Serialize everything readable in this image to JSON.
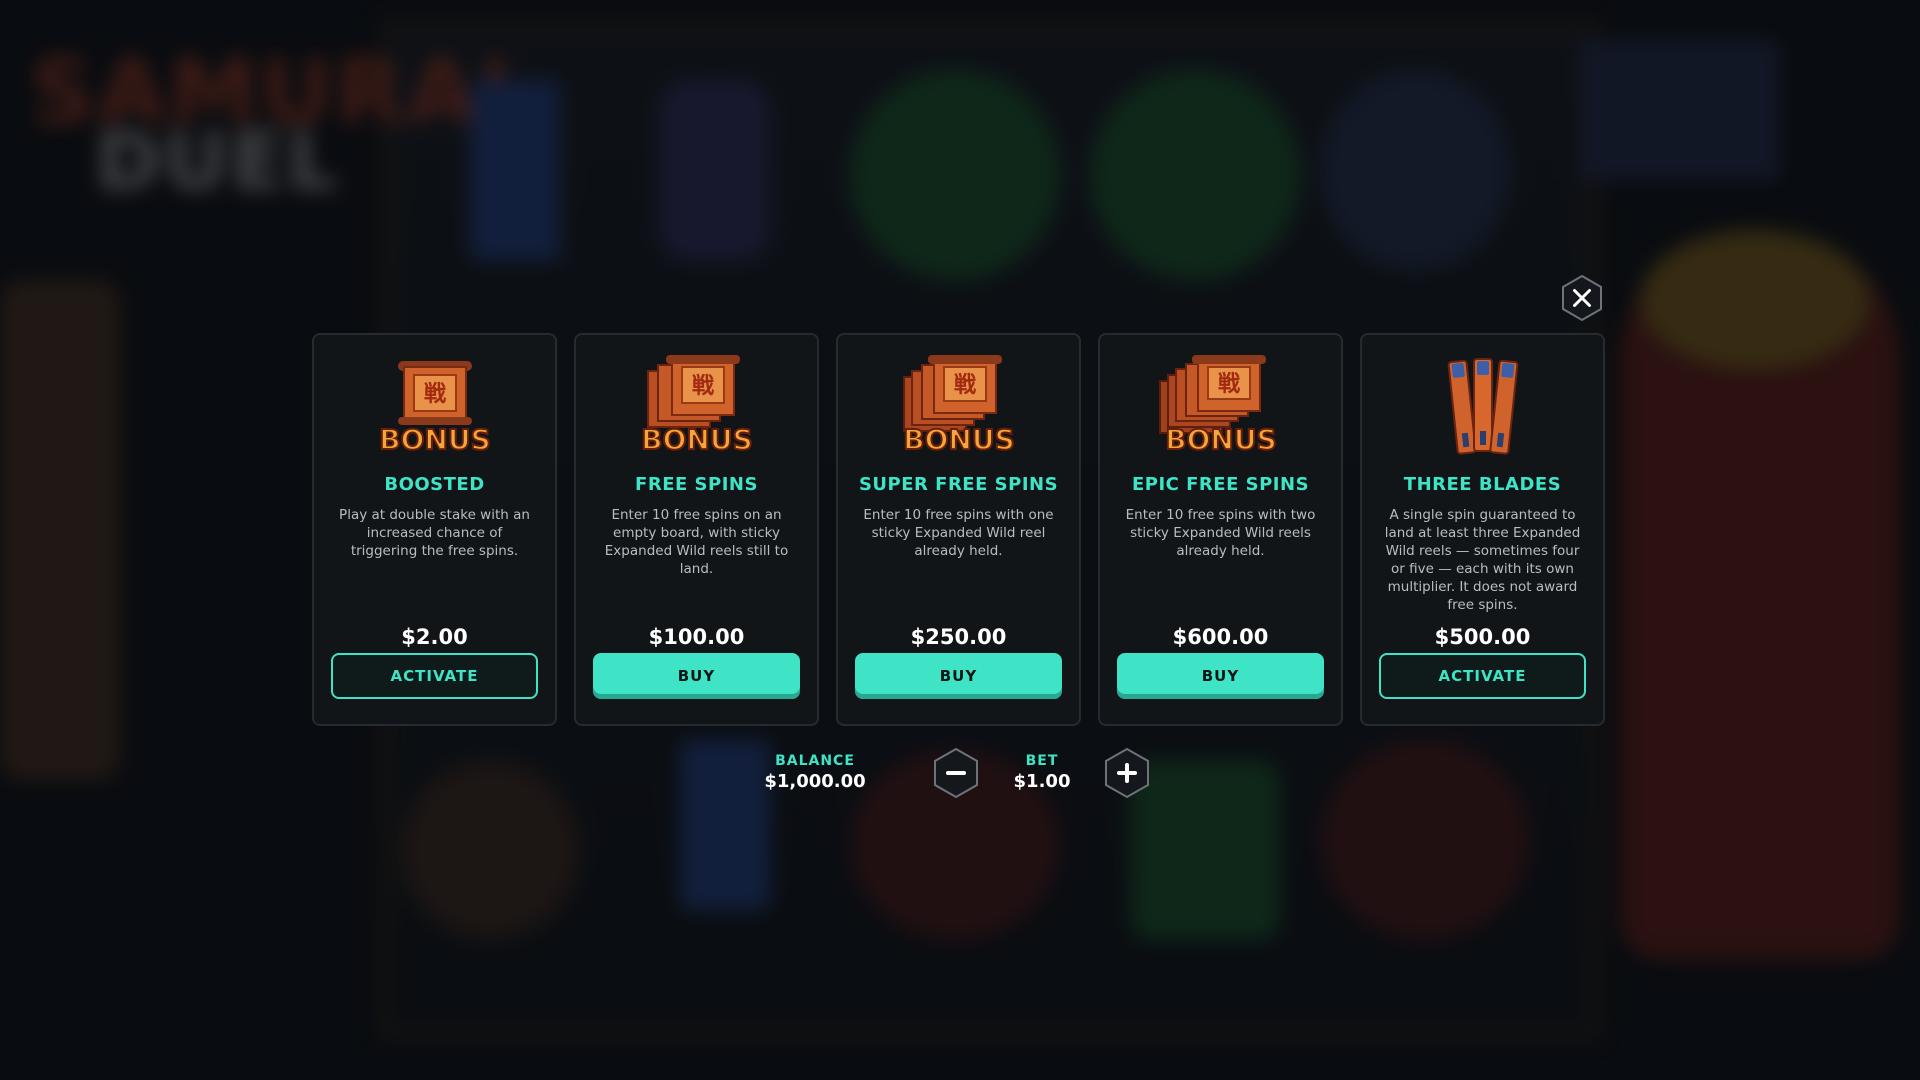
{
  "background": {
    "logo_line1": "SAMURAI",
    "logo_line2": "DUEL"
  },
  "cards": [
    {
      "id": "boosted",
      "title": "BOOSTED",
      "description": "Play at double stake with an increased chance of triggering the free spins.",
      "price": "$2.00",
      "button": "ACTIVATE",
      "button_style": "outline",
      "icon": "bonus-scroll-icon",
      "icon_text": "BONUS"
    },
    {
      "id": "free-spins",
      "title": "FREE SPINS",
      "description": "Enter 10 free spins on an empty board, with sticky Expanded Wild reels still to land.",
      "price": "$100.00",
      "button": "BUY",
      "button_style": "solid",
      "icon": "bonus-scroll-stack-icon",
      "icon_text": "BONUS"
    },
    {
      "id": "super-free-spins",
      "title": "SUPER FREE SPINS",
      "description": "Enter 10 free spins with one sticky Expanded Wild reel already held.",
      "price": "$250.00",
      "button": "BUY",
      "button_style": "solid",
      "icon": "bonus-scroll-stack-icon",
      "icon_text": "BONUS"
    },
    {
      "id": "epic-free-spins",
      "title": "EPIC FREE SPINS",
      "description": "Enter 10 free spins with two sticky Expanded Wild reels already held.",
      "price": "$600.00",
      "button": "BUY",
      "button_style": "solid",
      "icon": "bonus-scroll-stack-icon",
      "icon_text": "BONUS"
    },
    {
      "id": "three-blades",
      "title": "THREE BLADES",
      "description": "A single spin guaranteed to land at least three Expanded Wild reels — sometimes four or five — each with its own multiplier. It does not award free spins.",
      "price": "$500.00",
      "button": "ACTIVATE",
      "button_style": "outline",
      "icon": "three-blades-icon"
    }
  ],
  "controls": {
    "balance_label": "BALANCE",
    "balance_value": "$1,000.00",
    "bet_label": "BET",
    "bet_value": "$1.00",
    "decrease_icon": "minus-icon",
    "increase_icon": "plus-icon",
    "close_icon": "close-icon"
  },
  "colors": {
    "accent": "#3fe4c6",
    "card_bg": "#121518",
    "card_border": "#262b31",
    "scroll": "#c9572a",
    "scroll_text": "#f3a63a"
  }
}
